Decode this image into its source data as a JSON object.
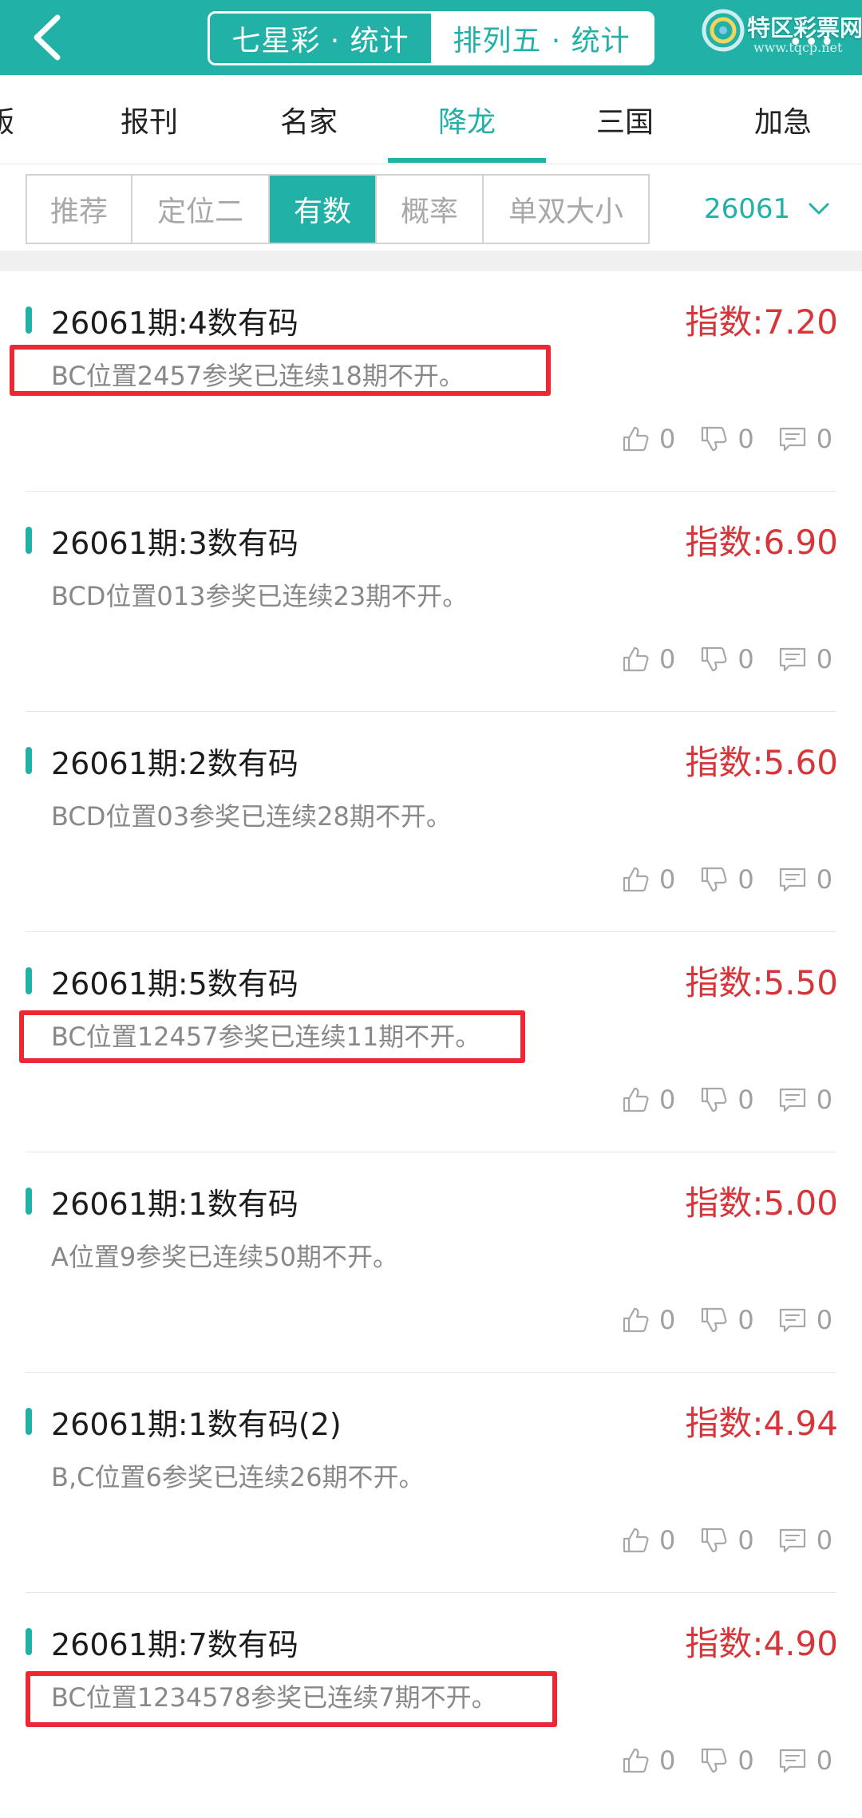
{
  "header": {
    "tabs": [
      {
        "label": "七星彩 · 统计"
      },
      {
        "label": "排列五 · 统计"
      }
    ],
    "brand_name": "特区彩票网",
    "brand_url": "www.tqcp.net",
    "more_dots": "•••",
    "colors": {
      "accent": "#22b1a6",
      "index_red": "#d7353a",
      "highlight_box": "#ec2833"
    }
  },
  "categories": [
    {
      "label": "版"
    },
    {
      "label": "报刊"
    },
    {
      "label": "名家"
    },
    {
      "label": "降龙"
    },
    {
      "label": "三国"
    },
    {
      "label": "加急"
    }
  ],
  "active_category": "降龙",
  "filters": [
    {
      "label": "推荐"
    },
    {
      "label": "定位二"
    },
    {
      "label": "有数"
    },
    {
      "label": "概率"
    },
    {
      "label": "单双大小"
    }
  ],
  "active_filter": "有数",
  "period": "26061",
  "items": [
    {
      "title": "26061期:4数有码",
      "index": "指数:7.20",
      "desc": "BC位置2457参奖已连续18期不开。",
      "likes": "0",
      "dislikes": "0",
      "comments": "0"
    },
    {
      "title": "26061期:3数有码",
      "index": "指数:6.90",
      "desc": "BCD位置013参奖已连续23期不开。",
      "likes": "0",
      "dislikes": "0",
      "comments": "0"
    },
    {
      "title": "26061期:2数有码",
      "index": "指数:5.60",
      "desc": "BCD位置03参奖已连续28期不开。",
      "likes": "0",
      "dislikes": "0",
      "comments": "0"
    },
    {
      "title": "26061期:5数有码",
      "index": "指数:5.50",
      "desc": "BC位置12457参奖已连续11期不开。",
      "likes": "0",
      "dislikes": "0",
      "comments": "0"
    },
    {
      "title": "26061期:1数有码",
      "index": "指数:5.00",
      "desc": "A位置9参奖已连续50期不开。",
      "likes": "0",
      "dislikes": "0",
      "comments": "0"
    },
    {
      "title": "26061期:1数有码(2)",
      "index": "指数:4.94",
      "desc": "B,C位置6参奖已连续26期不开。",
      "likes": "0",
      "dislikes": "0",
      "comments": "0"
    },
    {
      "title": "26061期:7数有码",
      "index": "指数:4.90",
      "desc": "BC位置1234578参奖已连续7期不开。",
      "likes": "0",
      "dislikes": "0",
      "comments": "0"
    }
  ]
}
